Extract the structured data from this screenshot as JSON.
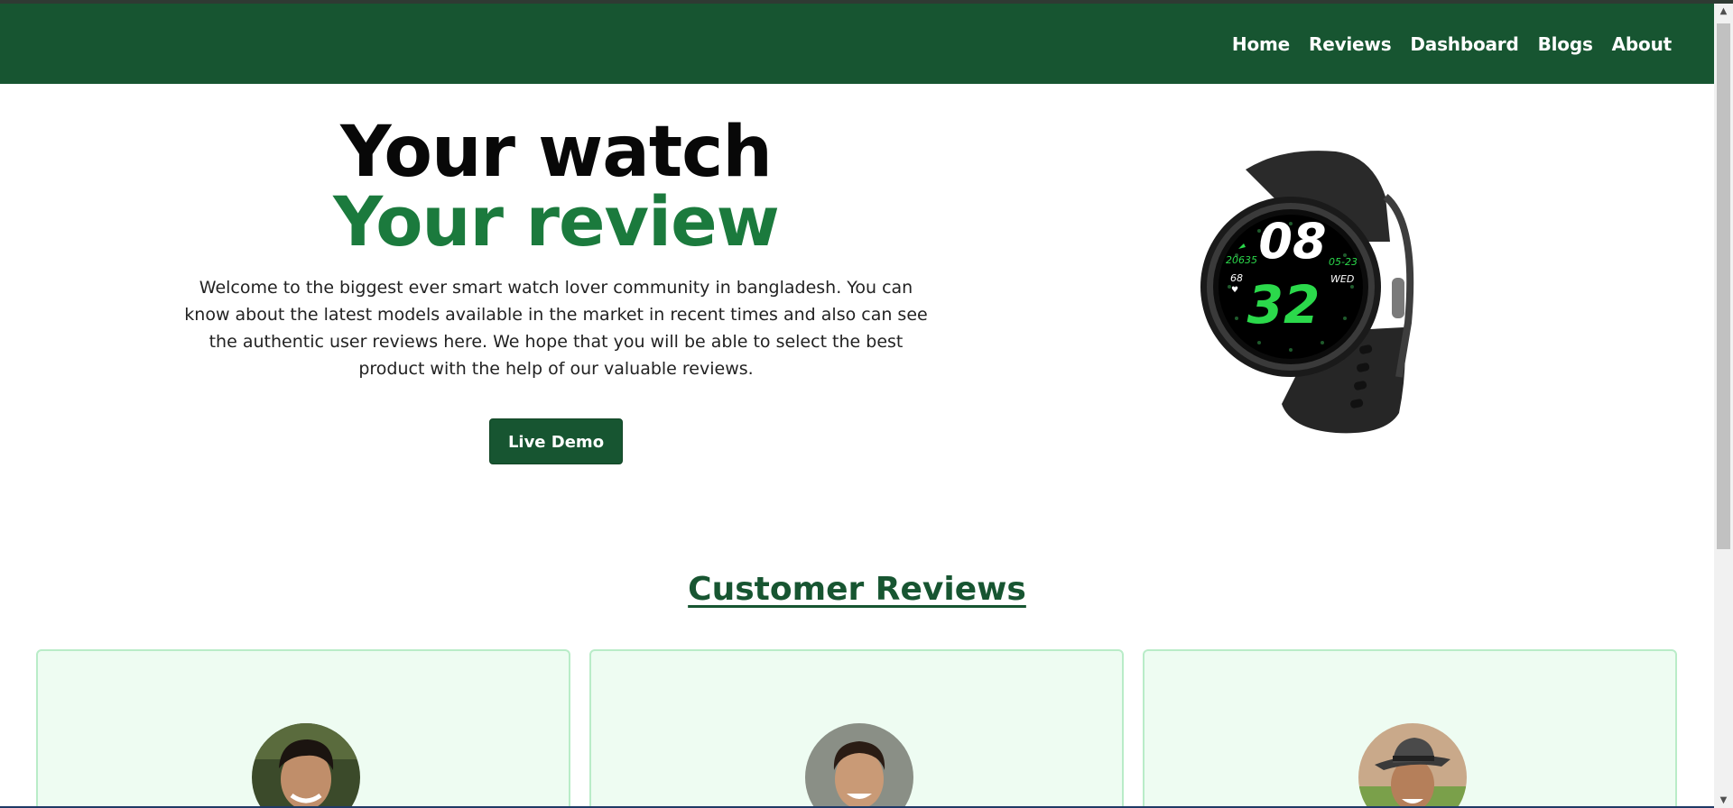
{
  "nav": {
    "items": [
      {
        "label": "Home"
      },
      {
        "label": "Reviews"
      },
      {
        "label": "Dashboard"
      },
      {
        "label": "Blogs"
      },
      {
        "label": "About"
      }
    ]
  },
  "hero": {
    "title_line1": "Your watch",
    "title_line2": "Your review",
    "description": "Welcome to the biggest ever smart watch lover community in bangladesh. You can know about the latest models available in the market in recent times and also can see the authentic user reviews here. We hope that you will be able to select the best product with the help of our valuable reviews.",
    "button_label": "Live Demo"
  },
  "watch": {
    "hour": "08",
    "minute": "32",
    "steps": "20635",
    "date": "05-23",
    "day": "WED",
    "heart_rate": "68"
  },
  "reviews": {
    "title": "Customer Reviews",
    "cards": [
      {
        "avatar": "reviewer-1"
      },
      {
        "avatar": "reviewer-2"
      },
      {
        "avatar": "reviewer-3"
      }
    ]
  },
  "colors": {
    "brand_green": "#175531",
    "accent_green": "#1b7a3d",
    "card_bg": "#eefcf2",
    "card_border": "#b9ecc8"
  }
}
